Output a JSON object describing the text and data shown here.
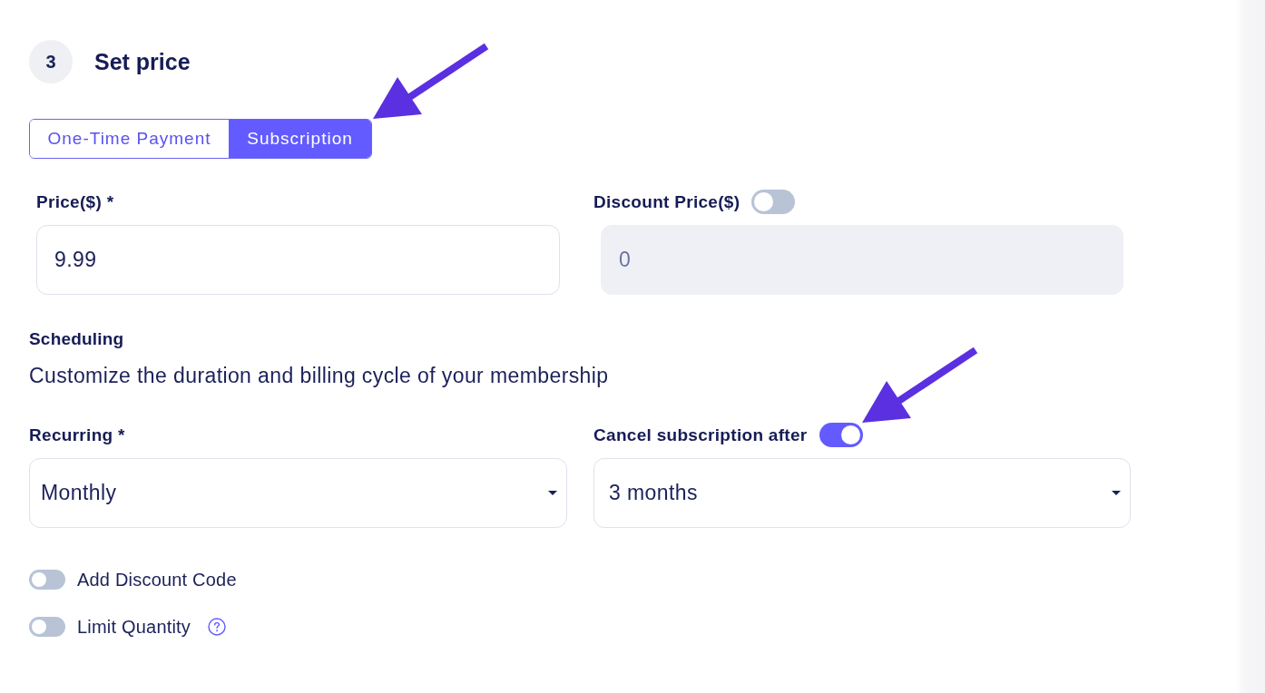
{
  "step": {
    "number": "3",
    "title": "Set price"
  },
  "payment_types": [
    {
      "label": "One-Time Payment",
      "selected": false
    },
    {
      "label": "Subscription",
      "selected": true
    }
  ],
  "price": {
    "label": "Price($) *",
    "value": "9.99"
  },
  "discount_price": {
    "label": "Discount Price($)",
    "on": false,
    "value": "0"
  },
  "scheduling": {
    "title": "Scheduling",
    "description": "Customize the duration and billing cycle of your membership"
  },
  "recurring": {
    "label": "Recurring *",
    "value": "Monthly"
  },
  "cancel_after": {
    "label": "Cancel subscription after",
    "on": true,
    "value": "3 months"
  },
  "options": [
    {
      "label": "Add Discount Code",
      "on": false,
      "help": false
    },
    {
      "label": "Limit Quantity",
      "on": false,
      "help": true
    }
  ]
}
